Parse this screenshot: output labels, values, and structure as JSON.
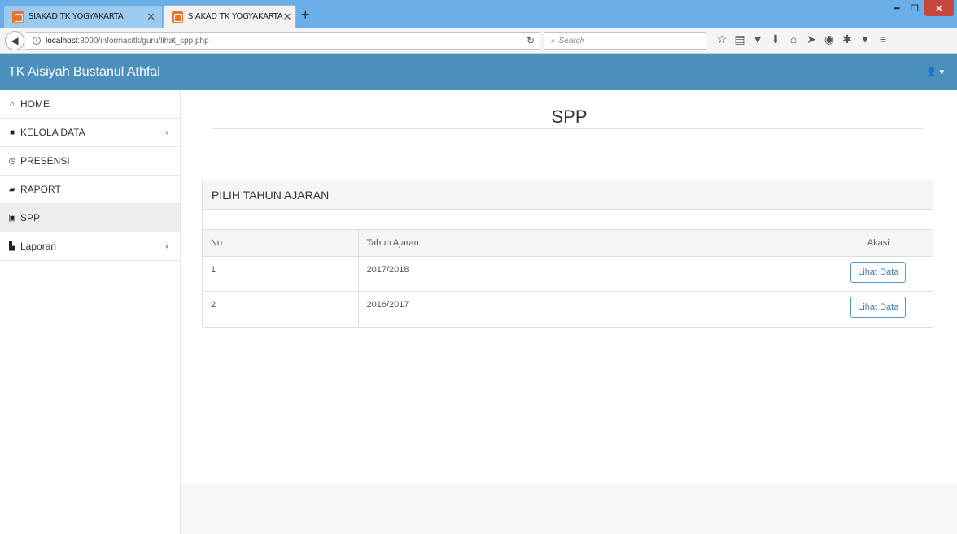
{
  "browser": {
    "tabs": [
      {
        "title": "SIAKAD TK YOGYAKARTA",
        "close": "✕"
      },
      {
        "title": "SIAKAD TK YOGYAKARTA",
        "close": "✕"
      }
    ],
    "new_tab": "+",
    "url_host": "localhost",
    "url_path": ":8090/informasitk/guru/lihat_spp.php",
    "search_placeholder": "Search"
  },
  "app": {
    "brand": "TK Aisiyah Bustanul Athfal",
    "user_menu": "▾"
  },
  "sidebar": {
    "items": [
      {
        "label": "HOME",
        "icon": "home-icon"
      },
      {
        "label": "KELOLA DATA",
        "icon": "folder-icon",
        "arrow": "‹"
      },
      {
        "label": "PRESENSI",
        "icon": "clock-icon"
      },
      {
        "label": "RAPORT",
        "icon": "book-icon"
      },
      {
        "label": "SPP",
        "icon": "money-icon"
      },
      {
        "label": "Laporan",
        "icon": "file-icon",
        "arrow": "‹"
      }
    ]
  },
  "main": {
    "title": "SPP",
    "panel": {
      "heading": "PILIH TAHUN AJARAN",
      "columns": [
        "No",
        "Tahun Ajaran",
        "Akasi"
      ],
      "rows": [
        {
          "no": "1",
          "tahun": "2017/2018",
          "action": "Lihat Data"
        },
        {
          "no": "2",
          "tahun": "2016/2017",
          "action": "Lihat Data"
        }
      ]
    }
  },
  "colors": {
    "header": "#4b8fbd",
    "tabbar": "#6aaee8",
    "button_border": "#5b95c6"
  }
}
